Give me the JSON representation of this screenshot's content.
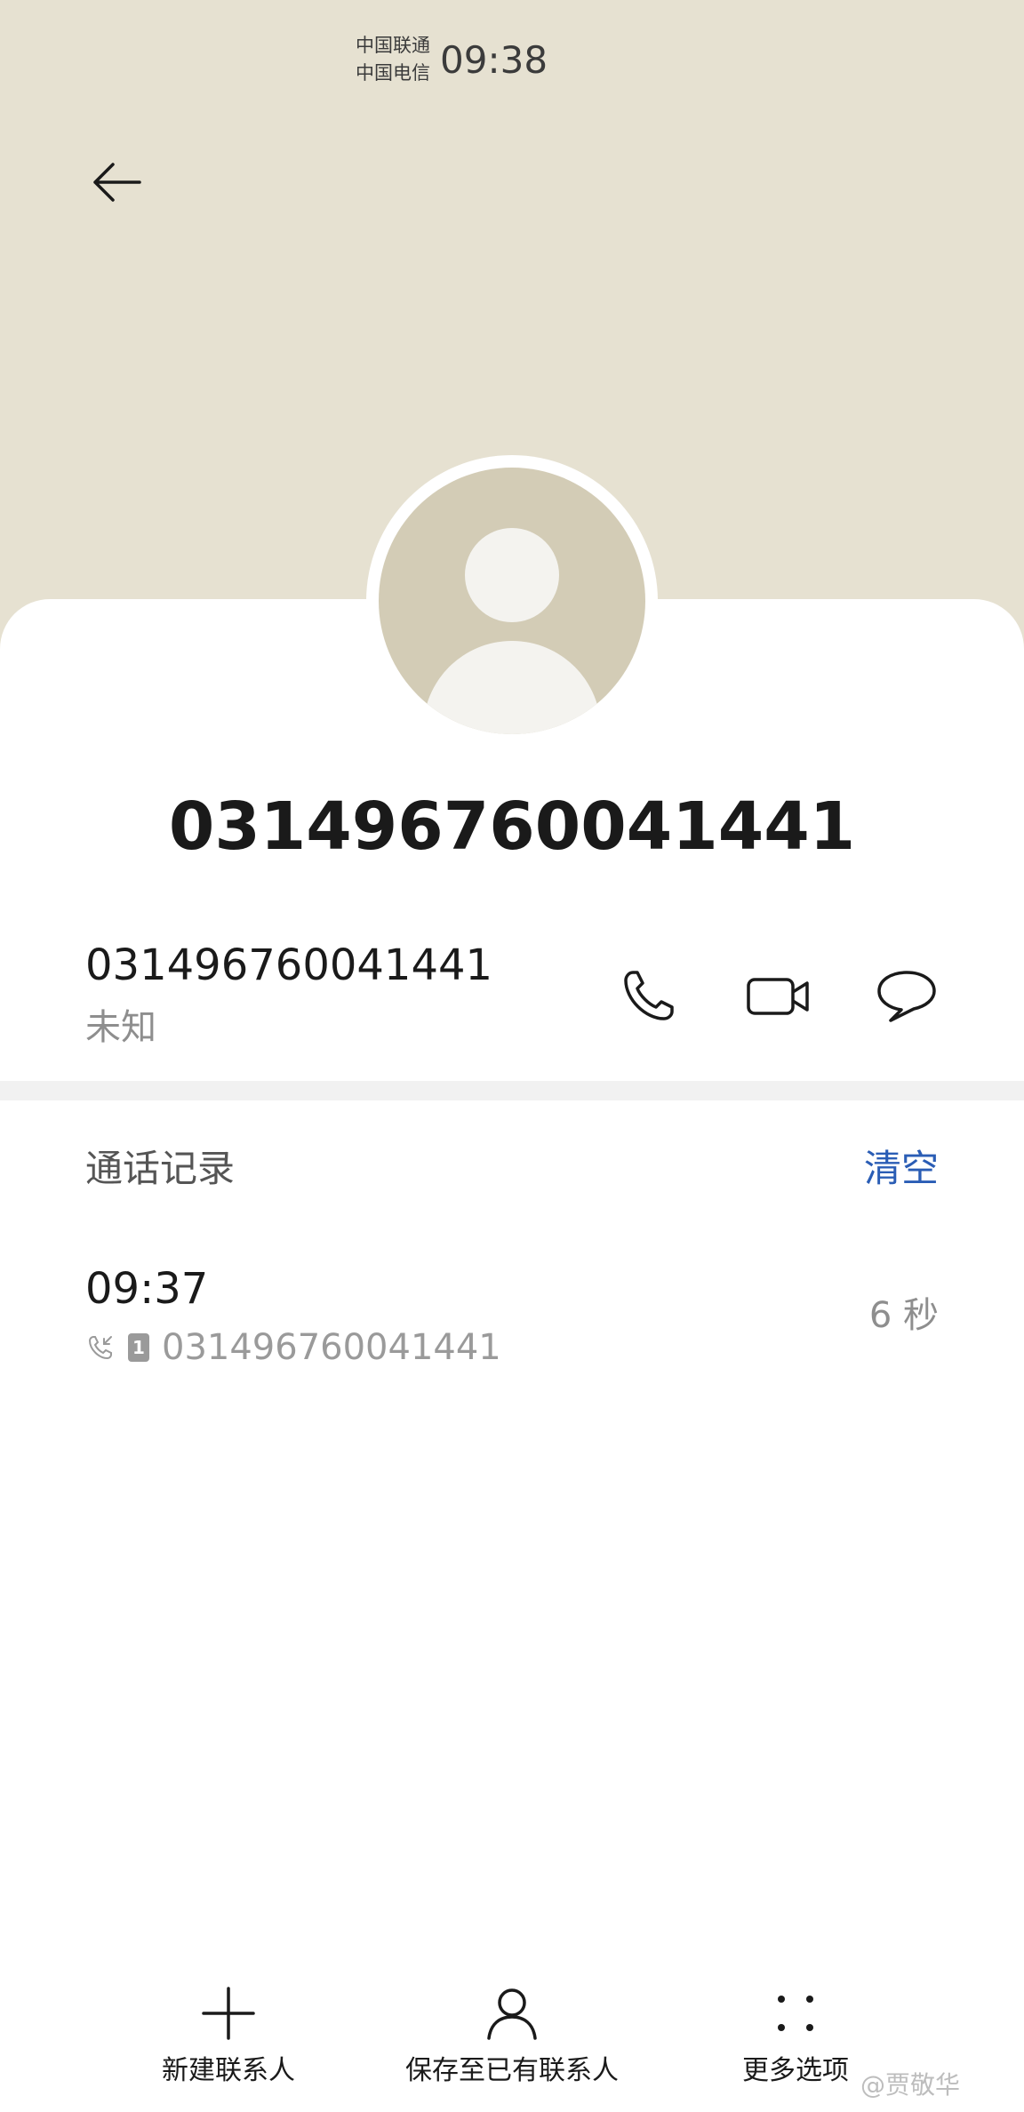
{
  "status_bar": {
    "carrier_1": "中国联通",
    "carrier_2": "中国电信",
    "time": "09:38"
  },
  "header": {
    "back_icon": "back-arrow-icon",
    "background_color": "#e6e1d1"
  },
  "contact": {
    "avatar_icon": "default-person-avatar",
    "title": "031496760041441",
    "number": "031496760041441",
    "number_label": "未知"
  },
  "actions": [
    {
      "icon": "phone-icon"
    },
    {
      "icon": "video-call-icon"
    },
    {
      "icon": "message-icon"
    }
  ],
  "call_log": {
    "section_title": "通话记录",
    "clear_label": "清空",
    "clear_color": "#2a5db5",
    "entries": [
      {
        "time": "09:37",
        "type_icon": "incoming-call-icon",
        "sim": "1",
        "number": "031496760041441",
        "duration": "6 秒"
      }
    ]
  },
  "bottom_bar": {
    "new_contact_label": "新建联系人",
    "save_existing_label": "保存至已有联系人",
    "more_options_label": "更多选项"
  },
  "watermark": "@贾敬华"
}
